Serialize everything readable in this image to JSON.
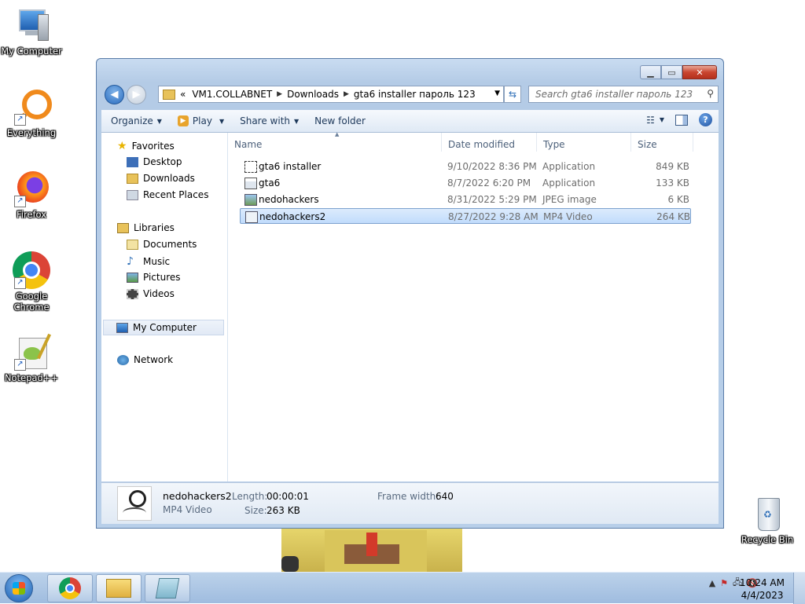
{
  "desktop": {
    "icons": [
      {
        "label": "My Computer"
      },
      {
        "label": "Everything"
      },
      {
        "label": "Firefox"
      },
      {
        "label": "Google Chrome"
      },
      {
        "label": "Notepad++"
      },
      {
        "label": "Recycle Bin"
      }
    ]
  },
  "window": {
    "breadcrumb_prefix": "«",
    "breadcrumbs": [
      "VM1.COLLABNET",
      "Downloads",
      "gta6 installer пароль 123"
    ],
    "search_placeholder": "Search gta6 installer пароль 123",
    "toolbar": {
      "organize": "Organize",
      "play": "Play",
      "share_with": "Share with",
      "new_folder": "New folder"
    },
    "nav": {
      "favorites": "Favorites",
      "desktop": "Desktop",
      "downloads": "Downloads",
      "recent": "Recent Places",
      "libraries": "Libraries",
      "documents": "Documents",
      "music": "Music",
      "pictures": "Pictures",
      "videos": "Videos",
      "my_computer": "My Computer",
      "network": "Network"
    },
    "columns": {
      "name": "Name",
      "date": "Date modified",
      "type": "Type",
      "size": "Size"
    },
    "files": [
      {
        "name": "gta6 installer",
        "date": "9/10/2022 8:36 PM",
        "type": "Application",
        "size": "849 KB"
      },
      {
        "name": "gta6",
        "date": "8/7/2022 6:20 PM",
        "type": "Application",
        "size": "133 KB"
      },
      {
        "name": "nedohackers",
        "date": "8/31/2022 5:29 PM",
        "type": "JPEG image",
        "size": "6 KB"
      },
      {
        "name": "nedohackers2",
        "date": "8/27/2022 9:28 AM",
        "type": "MP4 Video",
        "size": "264 KB"
      }
    ],
    "details": {
      "name": "nedohackers2",
      "type": "MP4 Video",
      "length_label": "Length:",
      "length": "00:00:01",
      "size_label": "Size:",
      "size": "263 KB",
      "frame_label": "Frame width:",
      "frame": "640"
    }
  },
  "taskbar": {
    "time": "10:24 AM",
    "date": "4/4/2023"
  }
}
